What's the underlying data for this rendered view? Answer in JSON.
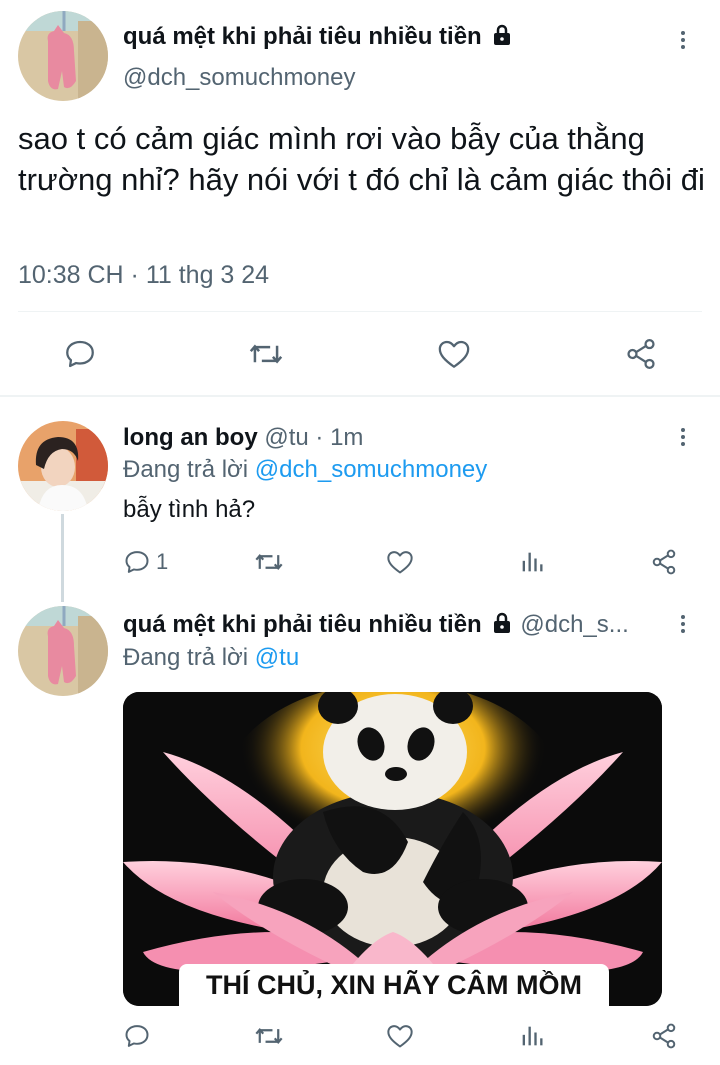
{
  "main_tweet": {
    "display_name": "quá mệt khi phải tiêu nhiều tiền",
    "handle": "@dch_somuchmoney",
    "text": "sao t có cảm giác mình rơi vào bẫy của thằng trường nhỉ? hãy nói với t đó chỉ là cảm giác thôi đi",
    "timestamp": "10:38 CH · 11 thg 3 24",
    "icons": [
      "comment-icon",
      "retweet-icon",
      "like-icon",
      "share-icon"
    ]
  },
  "reply_1": {
    "display_name": "long an boy",
    "handle": "@tu",
    "dot": "·",
    "time": "1m",
    "replying_label": "Đang trả lời",
    "replying_to": "@dch_somuchmoney",
    "text": "bẫy tình hả?",
    "reply_count": "1"
  },
  "reply_2": {
    "display_name": "quá mệt khi phải tiêu nhiều tiền",
    "handle": "@dch_s...",
    "replying_label": "Đang trả lời",
    "replying_to": "@tu",
    "image_caption": "THÍ CHỦ, XIN HÃY CÂM MỒM"
  },
  "colors": {
    "link": "#1d9bf0",
    "muted": "#536471",
    "text": "#0f1419"
  }
}
